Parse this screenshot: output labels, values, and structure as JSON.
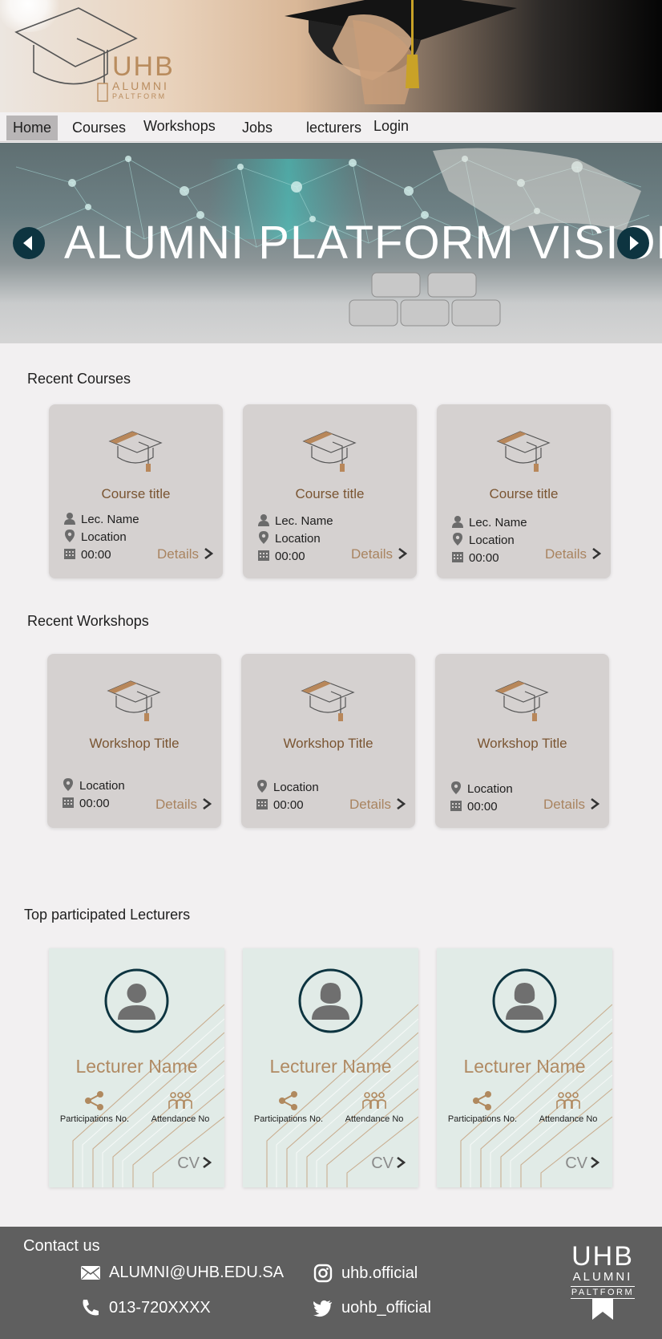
{
  "brand": {
    "name": "UHB",
    "line2": "ALUMNI",
    "line3": "PALTFORM"
  },
  "nav": {
    "items": [
      {
        "label": "Home",
        "active": true
      },
      {
        "label": "Courses"
      },
      {
        "label": "Workshops"
      },
      {
        "label": "Jobs"
      },
      {
        "label": "lecturers"
      },
      {
        "label": "Login"
      }
    ]
  },
  "hero": {
    "title": "ALUMNI PLATFORM VISION",
    "prev_icon": "chevron-left-icon",
    "next_icon": "chevron-right-icon"
  },
  "courses": {
    "section_title": "Recent Courses",
    "items": [
      {
        "title": "Course title",
        "lecturer": "Lec. Name",
        "location": "Location",
        "time": "00:00",
        "details": "Details"
      },
      {
        "title": "Course title",
        "lecturer": "Lec. Name",
        "location": "Location",
        "time": "00:00",
        "details": "Details"
      },
      {
        "title": "Course title",
        "lecturer": "Lec. Name",
        "location": "Location",
        "time": "00:00",
        "details": "Details"
      }
    ]
  },
  "workshops": {
    "section_title": "Recent Workshops",
    "items": [
      {
        "title": "Workshop Title",
        "location": "Location",
        "time": "00:00",
        "details": "Details"
      },
      {
        "title": "Workshop Title",
        "location": "Location",
        "time": "00:00",
        "details": "Details"
      },
      {
        "title": "Workshop Title",
        "location": "Location",
        "time": "00:00",
        "details": "Details"
      }
    ]
  },
  "lecturers": {
    "section_title": "Top participated Lecturers",
    "items": [
      {
        "name": "Lecturer Name",
        "participations": "Participations No.",
        "attendance": "Attendance No",
        "cv": "CV"
      },
      {
        "name": "Lecturer Name",
        "participations": "Participations No.",
        "attendance": "Attendance No",
        "cv": "CV"
      },
      {
        "name": "Lecturer Name",
        "participations": "Participations No.",
        "attendance": "Attendance No",
        "cv": "CV"
      }
    ]
  },
  "footer": {
    "title": "Contact us",
    "email": "ALUMNI@UHB.EDU.SA",
    "phone": "013-720XXXX",
    "instagram": "uhb.official",
    "twitter": "uohb_official"
  },
  "colors": {
    "accent_brown": "#b08a63",
    "title_brown": "#7a5532",
    "dark_teal": "#0d3440",
    "card_gray": "#d5d1d0",
    "lecturer_card": "#e1ebe7",
    "footer": "#5f5f5f"
  }
}
